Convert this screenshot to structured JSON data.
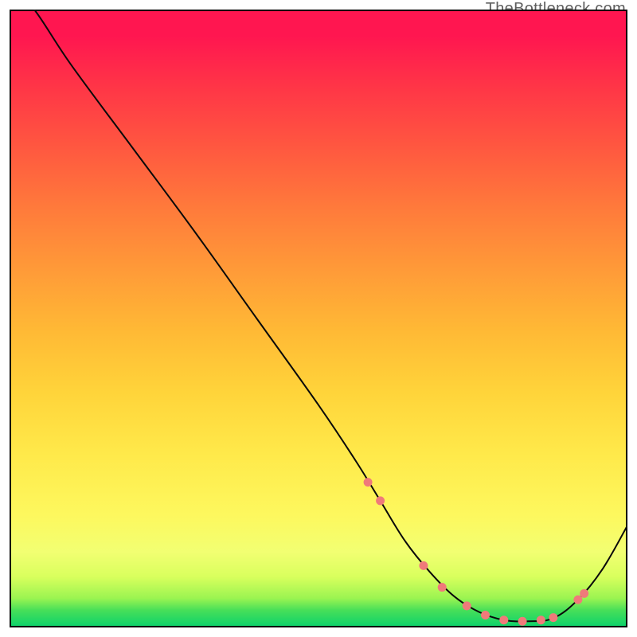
{
  "attribution": "TheBottleneck.com",
  "chart_data": {
    "type": "line",
    "title": "",
    "xlabel": "",
    "ylabel": "",
    "xlim": [
      0,
      100
    ],
    "ylim": [
      0,
      100
    ],
    "series": [
      {
        "name": "bottleneck-curve",
        "x": [
          0,
          4,
          10,
          20,
          30,
          40,
          50,
          56,
          60,
          64,
          68,
          72,
          76,
          80,
          84,
          88,
          92,
          96,
          100
        ],
        "values": [
          104,
          100,
          91,
          77.5,
          64,
          50,
          36,
          27,
          20.5,
          14,
          9.0,
          5.0,
          2.5,
          1.2,
          1.0,
          1.5,
          4.5,
          9.5,
          16.5
        ],
        "stroke": "#0a0a0a",
        "stroke_width": 2.0
      }
    ],
    "markers": {
      "name": "highlight-points",
      "shape": "circle",
      "fill": "#f07a7a",
      "stroke": "#f07a7a",
      "radius": 5.0,
      "points_xy": [
        [
          58,
          23.5
        ],
        [
          60,
          20.5
        ],
        [
          67,
          10.0
        ],
        [
          70,
          6.5
        ],
        [
          74,
          3.5
        ],
        [
          77,
          2.0
        ],
        [
          80,
          1.2
        ],
        [
          83,
          1.0
        ],
        [
          86,
          1.2
        ],
        [
          88,
          1.6
        ],
        [
          92,
          4.5
        ],
        [
          93,
          5.5
        ]
      ]
    },
    "gradient_stops": [
      {
        "pos": 0.0,
        "color": "#ff1650"
      },
      {
        "pos": 0.3,
        "color": "#ff7e3b"
      },
      {
        "pos": 0.6,
        "color": "#ffd43a"
      },
      {
        "pos": 0.85,
        "color": "#f3ff60"
      },
      {
        "pos": 0.97,
        "color": "#46df59"
      },
      {
        "pos": 1.0,
        "color": "#0fd26a"
      }
    ]
  }
}
